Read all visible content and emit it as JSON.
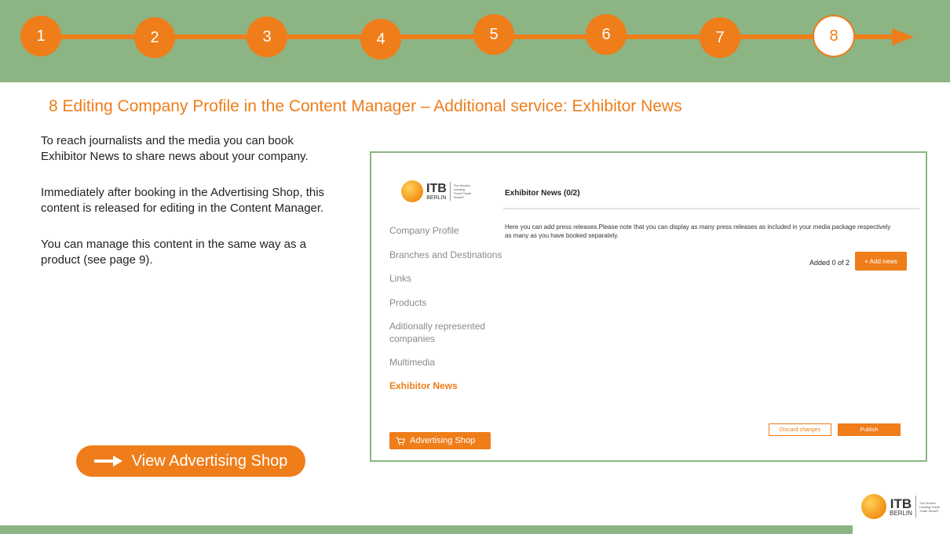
{
  "steps": [
    {
      "label": "1"
    },
    {
      "label": "2"
    },
    {
      "label": "3"
    },
    {
      "label": "4"
    },
    {
      "label": "5"
    },
    {
      "label": "6"
    },
    {
      "label": "7"
    },
    {
      "label": "8"
    }
  ],
  "active_step": 8,
  "title": "8 Editing Company Profile in the Content Manager – Additional service: Exhibitor News",
  "paragraphs": [
    "To reach journalists and the media you can book Exhibitor News to share news about your company.",
    "Immediately after booking in the Advertising Shop, this content is released for editing in the Content Manager.",
    "You can manage this content in the same way as a product (see page 9)."
  ],
  "cta": {
    "label": "View Advertising Shop",
    "icon": "arrow-right-icon"
  },
  "logo": {
    "itb": "ITB",
    "berlin": "BERLIN",
    "tagline": "The World's Leading Travel Trade Show®",
    "icon": "globe-ball-icon"
  },
  "content_manager": {
    "nav": [
      {
        "label": "Company Profile",
        "active": false
      },
      {
        "label": "Branches and Destinations",
        "active": false
      },
      {
        "label": "Links",
        "active": false
      },
      {
        "label": "Products",
        "active": false
      },
      {
        "label": "Aditionally represented companies",
        "active": false
      },
      {
        "label": "Multimedia",
        "active": false
      },
      {
        "label": "Exhibitor News",
        "active": true
      }
    ],
    "advertising_shop": {
      "label": "Advertising Shop",
      "icon": "cart-icon"
    },
    "panel_title": "Exhibitor News (0/2)",
    "description": "Here you can add press releases.Please note that you can display as many press releases as included in your media package respectively as many as you have booked separately.",
    "added_count": "Added 0 of 2",
    "add_button": "+ Add news",
    "discard_button": "Discard changes",
    "publish_button": "Publish"
  },
  "colors": {
    "orange": "#ef7d1a",
    "green": "#8db483"
  }
}
